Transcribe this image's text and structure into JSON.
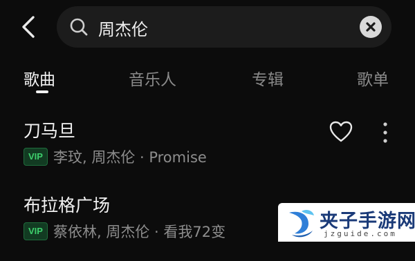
{
  "search": {
    "query": "周杰伦"
  },
  "tabs": [
    {
      "label": "歌曲",
      "active": true
    },
    {
      "label": "音乐人",
      "active": false
    },
    {
      "label": "专辑",
      "active": false
    },
    {
      "label": "歌单",
      "active": false
    }
  ],
  "songs": [
    {
      "title": "刀马旦",
      "badge": "VIP",
      "artists": "李玟, 周杰伦 · Promise",
      "actions": [
        "heart-icon",
        "more-vertical-icon"
      ]
    },
    {
      "title": "布拉格广场",
      "badge": "VIP",
      "artists": "蔡依林, 周杰伦 · 看我72变"
    }
  ],
  "watermark": {
    "title": "夹子手游网",
    "url": "jzguide.com"
  },
  "colors": {
    "background": "#0c0c0c",
    "search_bg": "#1c1c1c",
    "vip_green": "#3ecf6c",
    "muted_text": "#8d8d8d"
  }
}
